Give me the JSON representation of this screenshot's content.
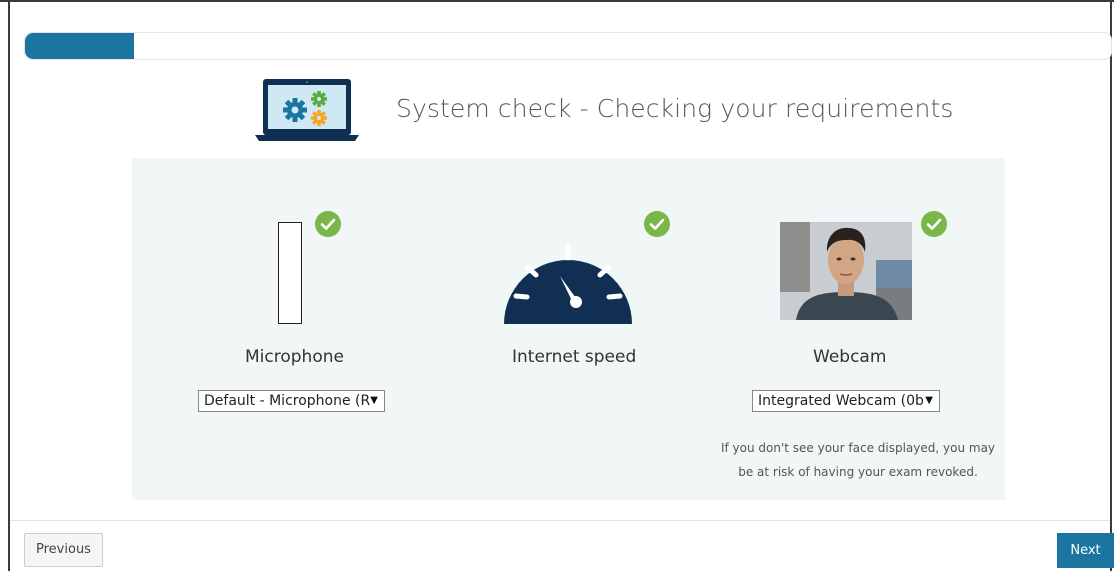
{
  "progress": {
    "fraction": 0.1
  },
  "header": {
    "title": "System check - Checking your requirements",
    "icon": "laptop-gears-icon"
  },
  "checks": {
    "microphone": {
      "label": "Microphone",
      "status": "passed",
      "device_selected": "Default - Microphone (R",
      "visual": "microphone-level-icon"
    },
    "internet": {
      "label": "Internet speed",
      "status": "passed",
      "visual": "speedometer-icon"
    },
    "webcam": {
      "label": "Webcam",
      "status": "passed",
      "device_selected": "Integrated Webcam (0b(",
      "warning_line1": "If you don't see your face displayed, you may",
      "warning_line2": "be at risk of having your exam revoked.",
      "visual": "webcam-preview"
    }
  },
  "footer": {
    "previous_label": "Previous",
    "next_label": "Next"
  },
  "colors": {
    "accent": "#1a76a0",
    "success": "#7ab648",
    "gauge": "#102f52",
    "panel_bg": "#f1f7f7"
  }
}
